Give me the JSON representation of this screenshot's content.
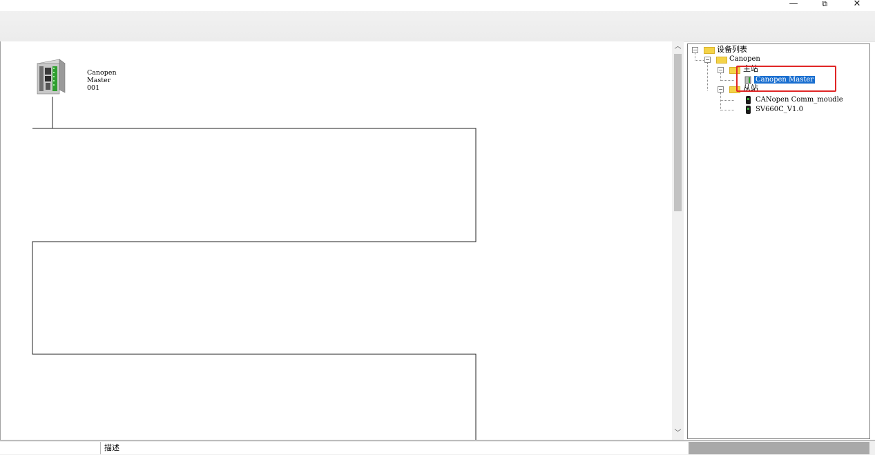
{
  "window": {
    "minimize_glyph": "—",
    "restore_glyph": "⧉",
    "close_glyph": "✕"
  },
  "canvas": {
    "master_device": {
      "name_line1": "Canopen",
      "name_line2": "Master",
      "node_id": "001"
    }
  },
  "tree": {
    "root": "设备列表",
    "network": "Canopen",
    "master_group": "主站",
    "master_item": "Canopen Master",
    "slave_group": "从站",
    "slave_items": [
      "CANopen Comm_moudle",
      "SV660C_V1.0"
    ]
  },
  "status": {
    "col1": "",
    "col2": "描述"
  },
  "colors": {
    "selection": "#1a6fd0",
    "highlight_box": "#e02525",
    "folder": "#f4d348"
  }
}
